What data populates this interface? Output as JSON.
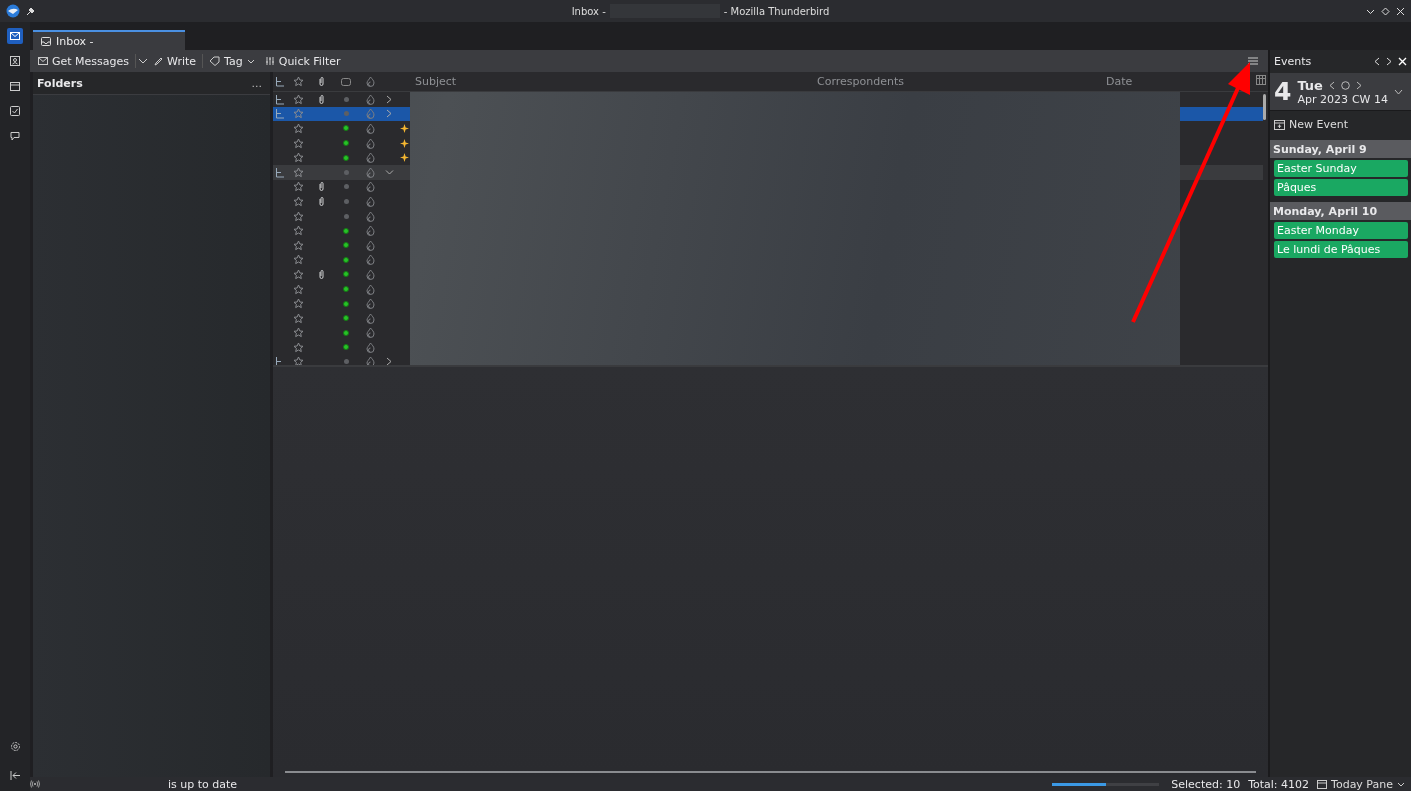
{
  "window": {
    "title_start": "Inbox -",
    "title_end": "- Mozilla Thunderbird"
  },
  "tabs": [
    {
      "label": "Inbox -",
      "selected": true
    }
  ],
  "toolbar": {
    "get_messages": "Get Messages",
    "write": "Write",
    "tag": "Tag",
    "quick_filter": "Quick Filter"
  },
  "folder_pane": {
    "title": "Folders",
    "more": "..."
  },
  "message_list": {
    "columns": [
      "Subject",
      "Correspondents",
      "Date"
    ],
    "rows": [
      {
        "expanded": false,
        "attachment": true,
        "unread": false,
        "new": false,
        "selected": false,
        "hovered": false
      },
      {
        "expanded": false,
        "attachment": false,
        "unread": false,
        "new": false,
        "selected": true,
        "hovered": false
      },
      {
        "attachment": false,
        "unread": true,
        "new": true,
        "selected": false,
        "hovered": false
      },
      {
        "attachment": false,
        "unread": true,
        "new": true,
        "selected": false,
        "hovered": false
      },
      {
        "attachment": false,
        "unread": true,
        "new": true,
        "selected": false,
        "hovered": false
      },
      {
        "expanded": true,
        "attachment": false,
        "unread": false,
        "new": false,
        "selected": false,
        "hovered": true
      },
      {
        "attachment": true,
        "unread": false,
        "new": false,
        "selected": false,
        "hovered": false
      },
      {
        "attachment": true,
        "unread": false,
        "new": false,
        "selected": false,
        "hovered": false
      },
      {
        "attachment": false,
        "unread": false,
        "new": false,
        "selected": false,
        "hovered": false
      },
      {
        "attachment": false,
        "unread": true,
        "new": false,
        "selected": false,
        "hovered": false
      },
      {
        "attachment": false,
        "unread": true,
        "new": false,
        "selected": false,
        "hovered": false
      },
      {
        "attachment": false,
        "unread": true,
        "new": false,
        "selected": false,
        "hovered": false
      },
      {
        "attachment": true,
        "unread": true,
        "new": false,
        "selected": false,
        "hovered": false
      },
      {
        "attachment": false,
        "unread": true,
        "new": false,
        "selected": false,
        "hovered": false
      },
      {
        "attachment": false,
        "unread": true,
        "new": false,
        "selected": false,
        "hovered": false
      },
      {
        "attachment": false,
        "unread": true,
        "new": false,
        "selected": false,
        "hovered": false
      },
      {
        "attachment": false,
        "unread": true,
        "new": false,
        "selected": false,
        "hovered": false
      },
      {
        "attachment": false,
        "unread": true,
        "new": false,
        "selected": false,
        "hovered": false
      },
      {
        "expanded": false,
        "attachment": false,
        "unread": false,
        "new": false,
        "selected": false,
        "hovered": false
      }
    ]
  },
  "today_pane": {
    "title": "Events",
    "day_number": "4",
    "weekday": "Tue",
    "month_year": "Apr 2023",
    "week": "CW 14",
    "new_event": "New Event",
    "days": [
      {
        "heading": "Sunday, April 9",
        "events": [
          {
            "title": "Easter Sunday",
            "color": "#1aa862"
          },
          {
            "title": "Pâques",
            "color": "#1aa862"
          }
        ]
      },
      {
        "heading": "Monday, April 10",
        "events": [
          {
            "title": "Easter Monday",
            "color": "#1aa862"
          },
          {
            "title": "Le lundi de Pâques",
            "color": "#1aa862"
          }
        ]
      }
    ]
  },
  "status_bar": {
    "message": "is up to date",
    "progress": {
      "level": 0.5
    },
    "selected": "Selected: 10",
    "total": "Total: 4102",
    "today_pane_toggle": "Today Pane"
  }
}
